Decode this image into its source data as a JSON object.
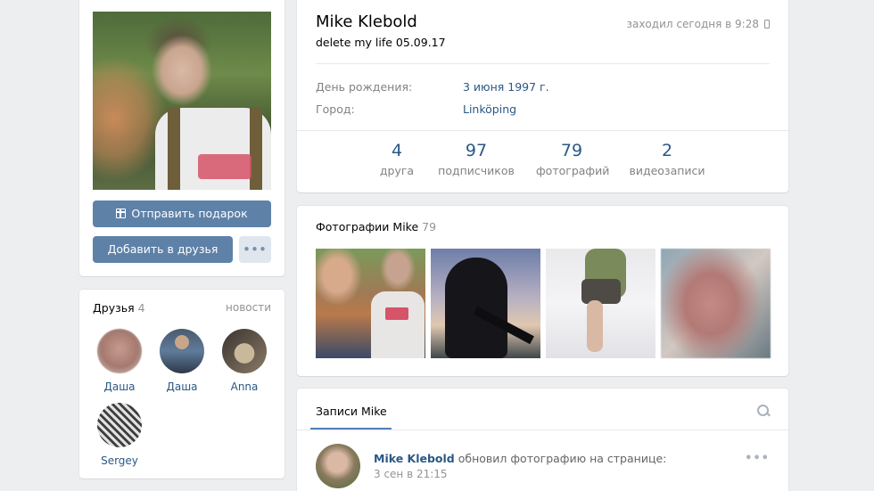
{
  "profile": {
    "name": "Mike Klebold",
    "status": "delete my life 05.09.17",
    "last_seen": "заходил сегодня в 9:28",
    "info": [
      {
        "label": "День рождения:",
        "value": "3 июня 1997 г."
      },
      {
        "label": "Город:",
        "value": "Linköping"
      }
    ],
    "counters": [
      {
        "value": "4",
        "label": "друга"
      },
      {
        "value": "97",
        "label": "подписчиков"
      },
      {
        "value": "79",
        "label": "фотографий"
      },
      {
        "value": "2",
        "label": "видеозаписи"
      }
    ]
  },
  "actions": {
    "gift": "Отправить подарок",
    "add_friend": "Добавить в друзья",
    "more": "•••"
  },
  "friends": {
    "title": "Друзья",
    "count": "4",
    "news": "новости",
    "items": [
      {
        "name": "Даша"
      },
      {
        "name": "Даша"
      },
      {
        "name": "Anna"
      },
      {
        "name": "Sergey"
      }
    ]
  },
  "photos": {
    "title": "Фотографии Mike",
    "count": "79"
  },
  "posts": {
    "tab": "Записи Mike",
    "author": "Mike Klebold",
    "action": "обновил фотографию на странице:",
    "date": "3 сен в 21:15",
    "menu": "•••"
  },
  "icons": {
    "gift": "gift-icon",
    "phone": "mobile-phone-icon",
    "search": "search-icon"
  },
  "colors": {
    "background": "#edeef0",
    "link": "#2a5885",
    "primary_button": "#5e81a8",
    "secondary_button": "#dfe6ed"
  }
}
